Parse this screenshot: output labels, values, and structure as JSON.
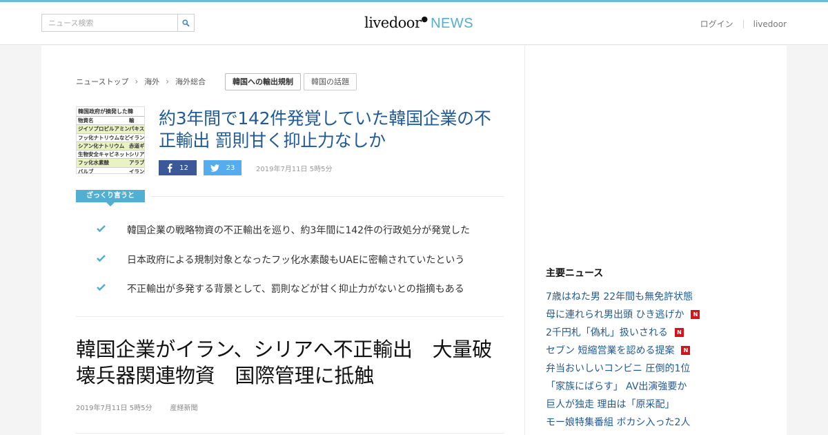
{
  "header": {
    "search_placeholder": "ニュース検索",
    "logo_main": "livedoor",
    "logo_sub": "NEWS",
    "login_label": "ログイン",
    "livedoor_label": "livedoor"
  },
  "breadcrumb": [
    "ニューストップ",
    "海外",
    "海外総合"
  ],
  "tags": [
    "韓国への輸出規制",
    "韓国の話題"
  ],
  "thumbnail": {
    "title": "韓国政府が摘発した韓",
    "header_left": "物資名",
    "header_right": "輸",
    "rows": [
      [
        "ジイソプロピルアミン",
        "パキス"
      ],
      [
        "フッ化ナトリウムなど",
        "イラン"
      ],
      [
        "シアン化ナトリウム",
        "赤道ギ"
      ],
      [
        "生物安全キャビネット",
        "シリア"
      ],
      [
        "フッ化水素酸",
        "アラブ"
      ],
      [
        "バルブ",
        "イラン"
      ]
    ]
  },
  "article": {
    "headline": "約3年間で142件発覚していた韓国企業の不正輸出 罰則甘く抑止力なしか",
    "facebook_count": "12",
    "twitter_count": "23",
    "date": "2019年7月11日 5時5分",
    "summary_label": "ざっくり言うと",
    "points": [
      "韓国企業の戦略物資の不正輸出を巡り、約3年間に142件の行政処分が発覚した",
      "日本政府による規制対象となったフッ化水素酸もUAEに密輸されていたという",
      "不正輸出が多発する背景として、罰則などが甘く抑止力がないとの指摘もある"
    ],
    "title": "韓国企業がイラン、シリアへ不正輸出　大量破壊兵器関連物資　国際管理に抵触",
    "meta_date": "2019年7月11日 5時5分",
    "source": "産経新聞"
  },
  "sidebar": {
    "news_title": "主要ニュース",
    "news_badge": "N",
    "news": [
      {
        "text": "7歳はねた男 22年間も無免許状態",
        "is_new": false
      },
      {
        "text": "母に連れられ男出頭 ひき逃げか",
        "is_new": true
      },
      {
        "text": "2千円札「偽札」扱いされる",
        "is_new": true
      },
      {
        "text": "セブン 短縮営業を認める提案",
        "is_new": true
      },
      {
        "text": "弁当おいしいコンビニ 圧倒的1位",
        "is_new": false
      },
      {
        "text": "「家族にばらす」 AV出演強要か",
        "is_new": false
      },
      {
        "text": "巨人が独走 理由は「原采配」",
        "is_new": false
      },
      {
        "text": "モー娘特集番組 ボカシ入った2人",
        "is_new": false
      }
    ]
  },
  "colors": {
    "accent": "#52afd4",
    "headline": "#1f5a9a",
    "facebook": "#3b5998",
    "twitter": "#55acee",
    "new_badge": "#d6131a"
  }
}
